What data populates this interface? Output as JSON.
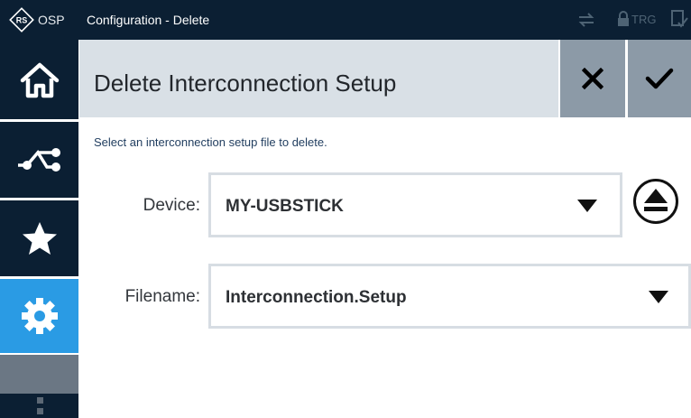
{
  "topbar": {
    "brand": "OSP",
    "window_title": "Configuration - Delete",
    "trigger_label": "TRG"
  },
  "sidebar": {
    "items": [
      {
        "name": "home",
        "icon": "home-icon"
      },
      {
        "name": "interconnection",
        "icon": "connection-icon"
      },
      {
        "name": "favorites",
        "icon": "star-icon"
      },
      {
        "name": "configuration",
        "icon": "gear-icon",
        "selected": true
      },
      {
        "name": "empty-slot"
      },
      {
        "name": "more",
        "icon": "more-dots-icon"
      }
    ]
  },
  "header": {
    "title": "Delete Interconnection Setup",
    "cancel_icon": "close-icon",
    "confirm_icon": "checkmark-icon"
  },
  "form": {
    "instruction": "Select an interconnection setup file to delete.",
    "device_label": "Device:",
    "device_value": "MY-USBSTICK",
    "filename_label": "Filename:",
    "filename_value": "Interconnection.Setup",
    "eject_icon": "eject-icon"
  },
  "colors": {
    "navy": "#0b1f33",
    "accent_blue": "#2a9be4",
    "header_bg": "#d9e0e6",
    "button_gray": "#8c9aa7"
  }
}
